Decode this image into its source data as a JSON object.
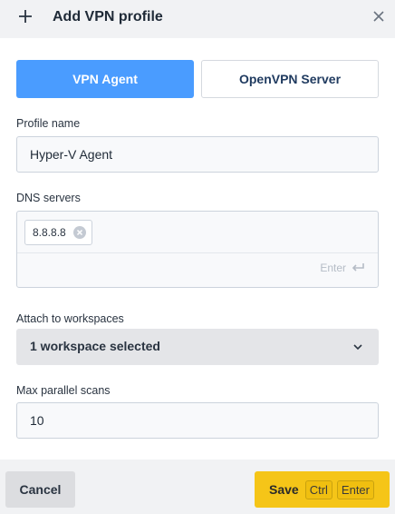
{
  "header": {
    "title": "Add VPN profile",
    "add_icon": "plus-icon",
    "close_icon": "close-icon"
  },
  "tabs": [
    {
      "label": "VPN Agent",
      "active": true
    },
    {
      "label": "OpenVPN Server",
      "active": false
    }
  ],
  "profile_name": {
    "label": "Profile name",
    "value": "Hyper-V Agent"
  },
  "dns": {
    "label": "DNS servers",
    "tags": [
      "8.8.8.8"
    ],
    "enter_hint": "Enter",
    "enter_icon": "enter-return-icon"
  },
  "workspaces": {
    "label": "Attach to workspaces",
    "selected": "1 workspace selected"
  },
  "max_scans": {
    "label": "Max parallel scans",
    "value": "10"
  },
  "footer": {
    "cancel_label": "Cancel",
    "save_label": "Save",
    "shortcut_keys": [
      "Ctrl",
      "Enter"
    ]
  },
  "colors": {
    "primary": "#4a9cff",
    "save": "#f5c518",
    "background": "#f1f2f4"
  }
}
